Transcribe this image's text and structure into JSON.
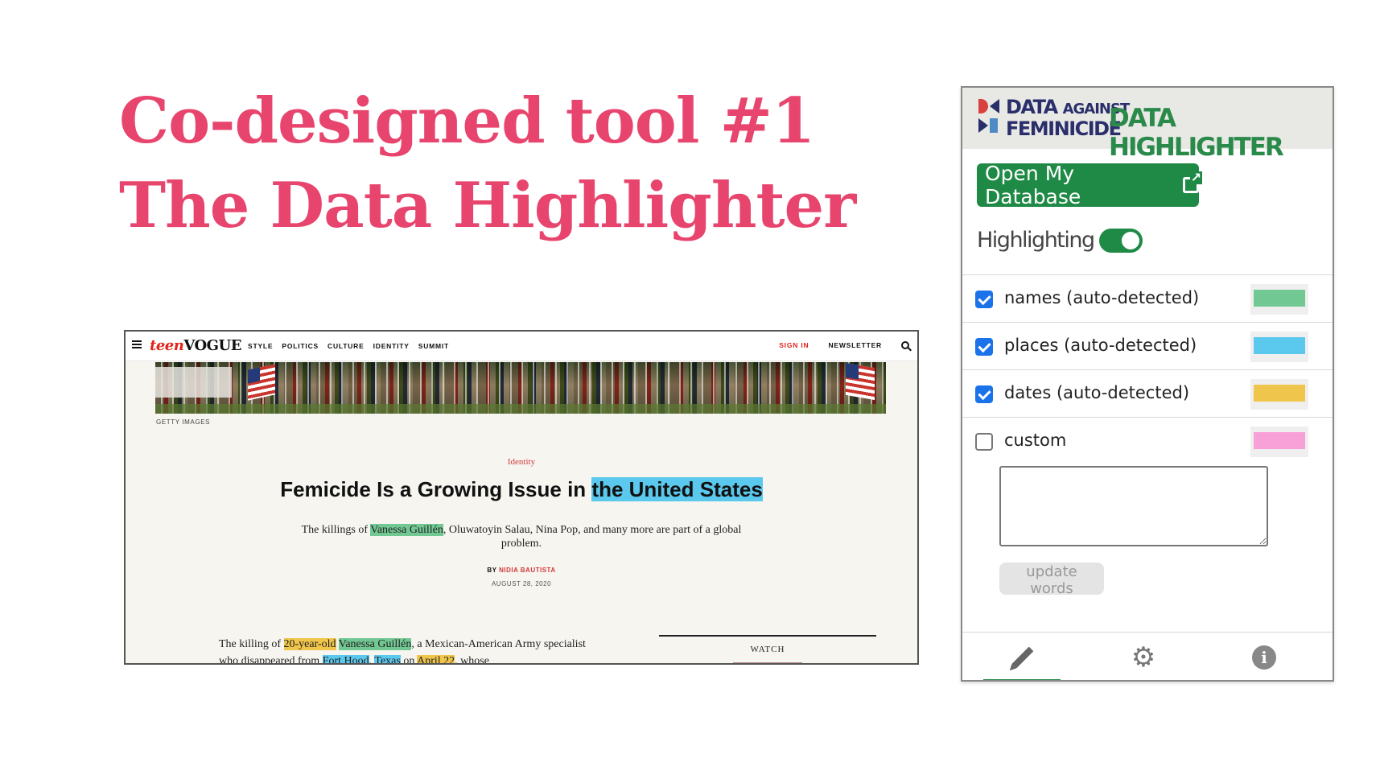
{
  "slide": {
    "title_line1": "Co-designed tool #1",
    "title_line2": "The Data Highlighter"
  },
  "article_screenshot": {
    "logo_prefix": "teen",
    "logo_suffix": "VOGUE",
    "nav_links": [
      "STYLE",
      "POLITICS",
      "CULTURE",
      "IDENTITY",
      "SUMMIT"
    ],
    "sign_in": "SIGN IN",
    "newsletter": "NEWSLETTER",
    "image_credit": "GETTY IMAGES",
    "rubric": "Identity",
    "headline_plain": "Femicide Is a Growing Issue in ",
    "headline_place": "the United States",
    "dek": {
      "before": "The killings of ",
      "name": "Vanessa Guillén",
      "after": ", Oluwatoyin Salau, Nina Pop, and many more are part of a global problem."
    },
    "byline_prefix": "BY ",
    "author": "NIDIA BAUTISTA",
    "date": "AUGUST 28, 2020",
    "body": {
      "t1": "The killing of ",
      "age": "20-year-old",
      "t2": " ",
      "name": "Vanessa Guillén",
      "t3": ", a Mexican-American Army specialist who disappeared from ",
      "place1": "Fort Hood",
      "t4": ", ",
      "place2": "Texas",
      "t5": " on ",
      "date": "April 22",
      "t6": ", whose"
    },
    "watch_label": "WATCH"
  },
  "extension": {
    "brand_line1": "DATA",
    "brand_line1_small": "AGAINST",
    "brand_line2": "FEMINICIDE",
    "title": "DATA HIGHLIGHTER",
    "open_db_label": "Open My Database",
    "highlighting_label": "Highlighting",
    "highlighting_on": true,
    "options": [
      {
        "label": "names (auto-detected)",
        "checked": true,
        "color": "#72c893"
      },
      {
        "label": "places (auto-detected)",
        "checked": true,
        "color": "#5bc8ee"
      },
      {
        "label": "dates (auto-detected)",
        "checked": true,
        "color": "#f0c54b"
      },
      {
        "label": "custom",
        "checked": false,
        "color": "#f8a0d8"
      }
    ],
    "custom_words_value": "",
    "update_button": "update words",
    "tabs": [
      {
        "icon": "pencil-icon",
        "active": true
      },
      {
        "icon": "gear-icon",
        "active": false
      },
      {
        "icon": "info-icon",
        "active": false
      }
    ],
    "colors": {
      "brand_green": "#1f8a46",
      "brand_navy": "#2a2f6c",
      "checkbox_blue": "#1a73e8"
    }
  }
}
